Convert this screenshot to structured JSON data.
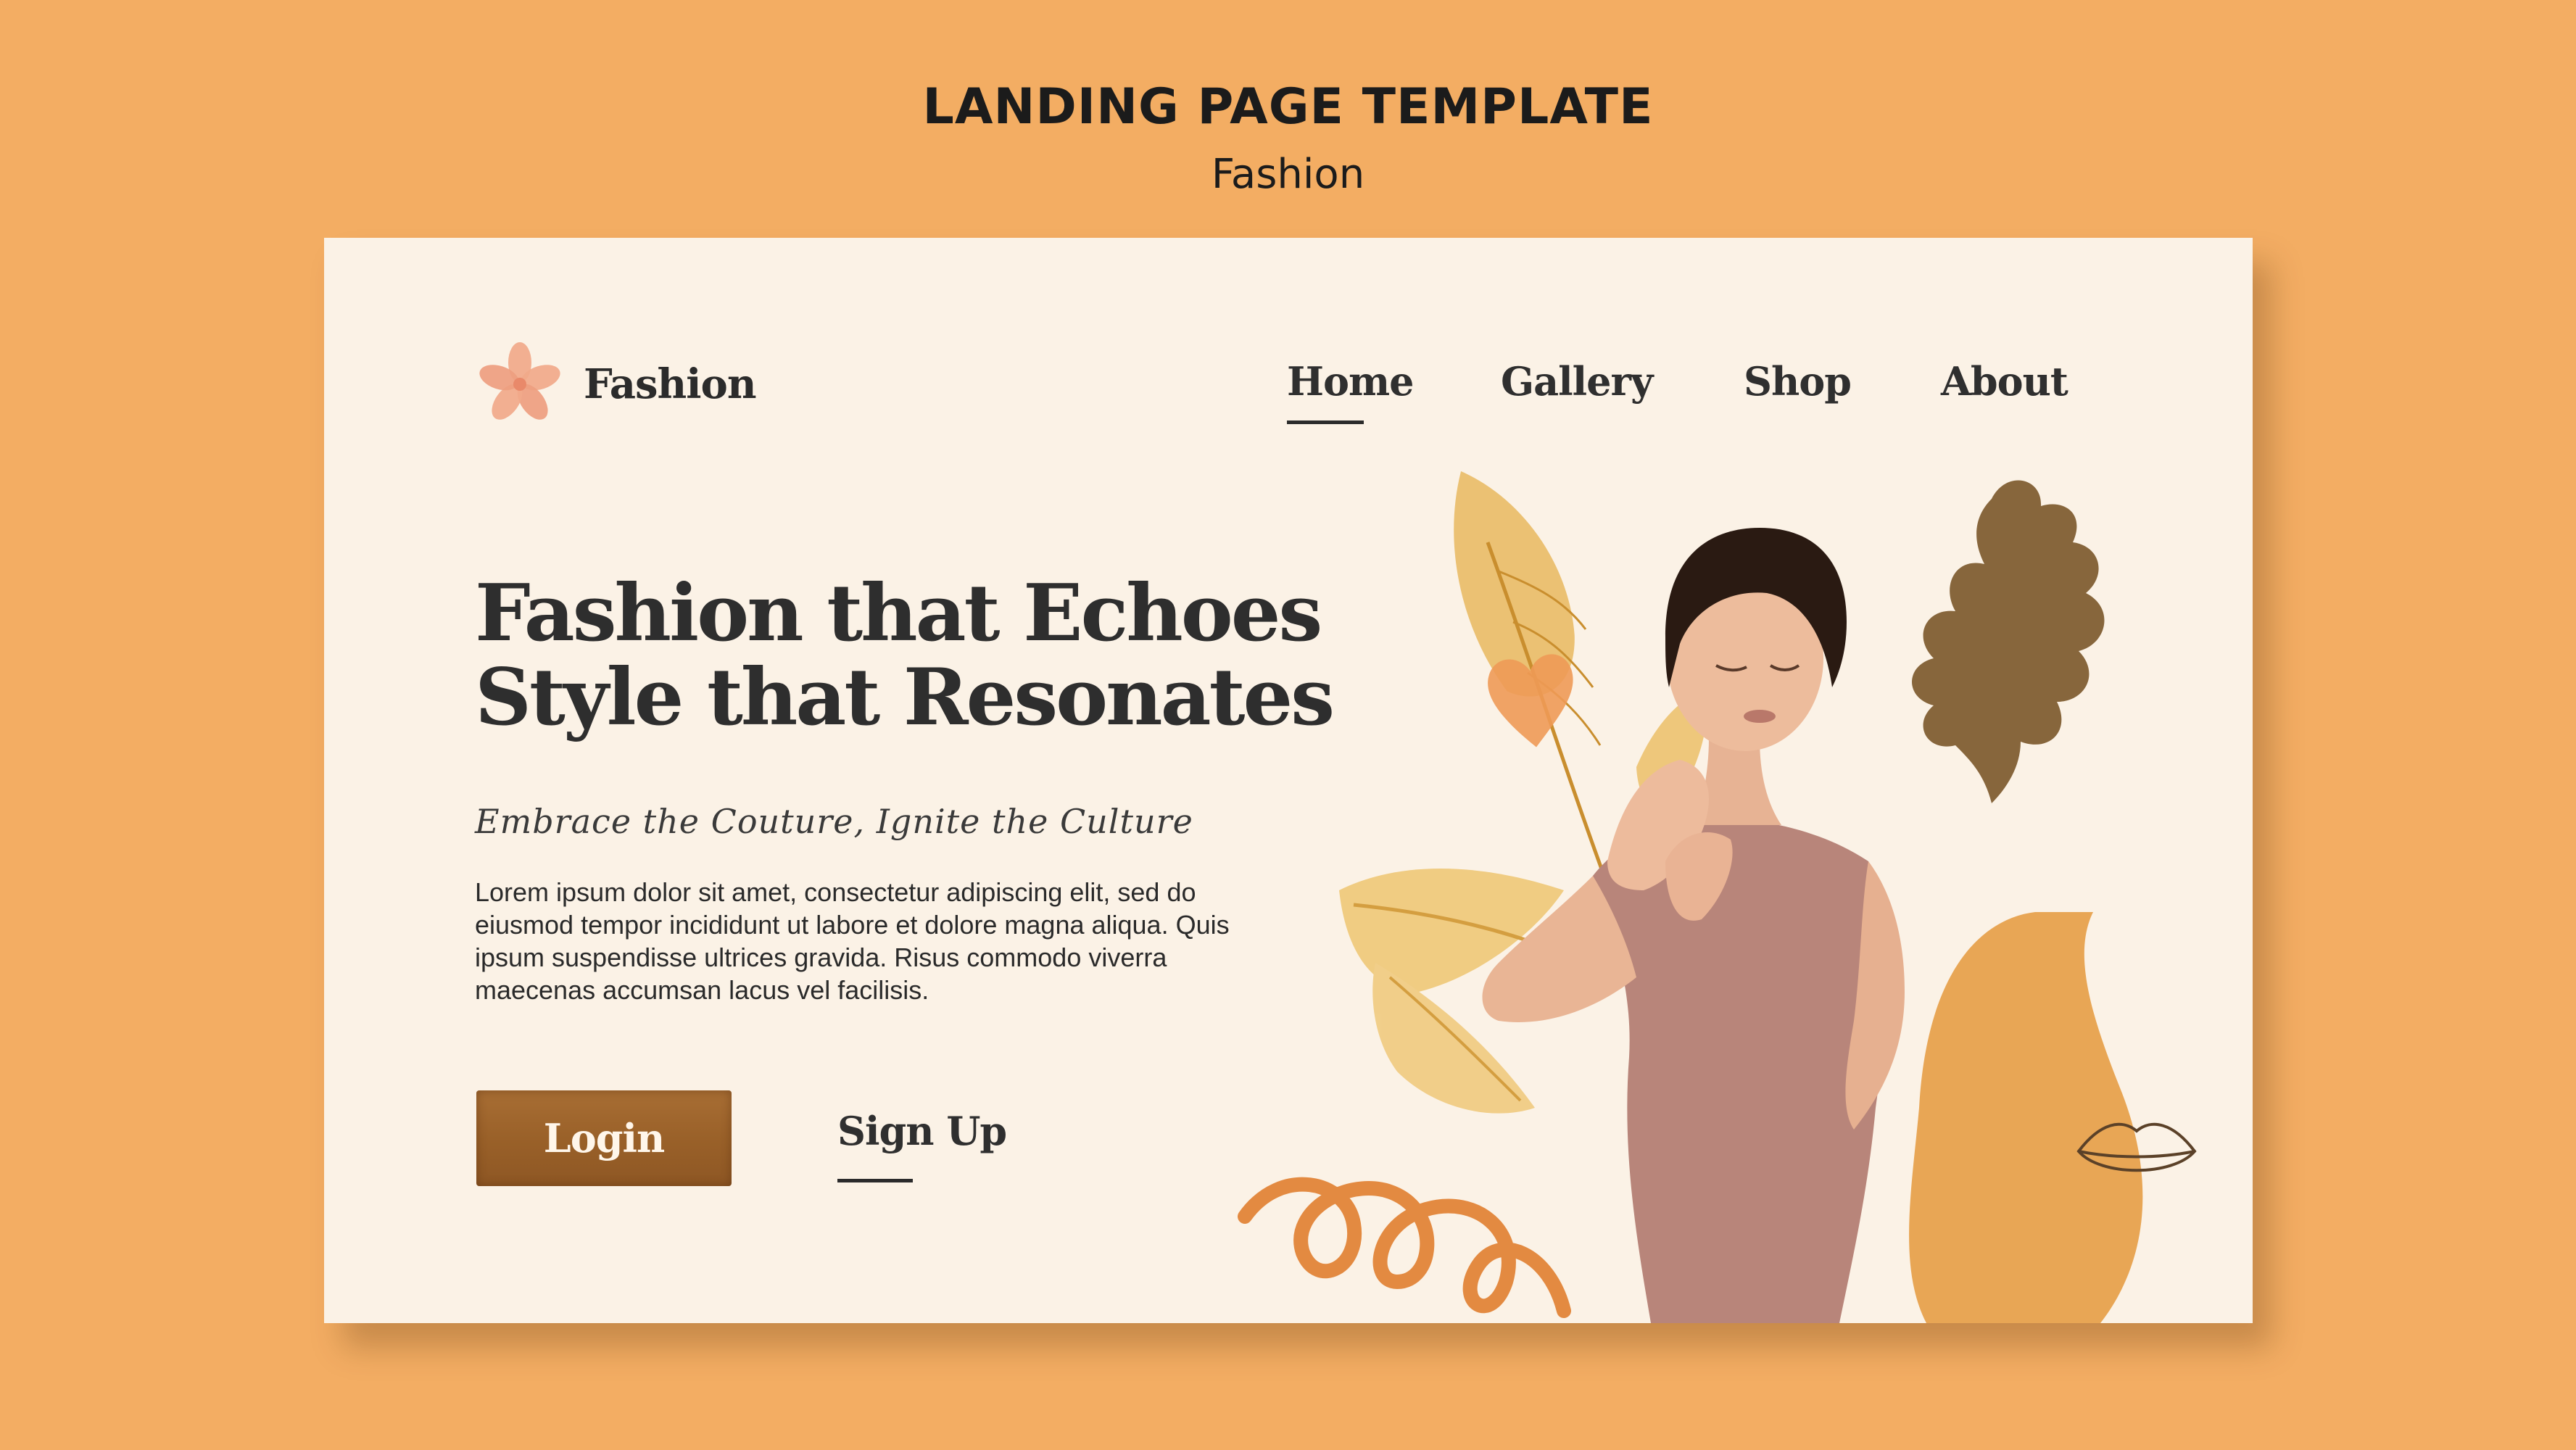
{
  "header": {
    "title": "LANDING PAGE TEMPLATE",
    "subtitle": "Fashion"
  },
  "site": {
    "logo_text": "Fashion",
    "logo_icon": "flower-icon"
  },
  "nav": {
    "items": [
      {
        "label": "Home",
        "active": true
      },
      {
        "label": "Gallery",
        "active": false
      },
      {
        "label": "Shop",
        "active": false
      },
      {
        "label": "About",
        "active": false
      }
    ]
  },
  "hero": {
    "title_line1": "Fashion that Echoes",
    "title_line2": "Style that Resonates",
    "tagline": "Embrace the Couture, Ignite the Culture",
    "body": "Lorem ipsum dolor sit amet, consectetur adipiscing elit, sed do eiusmod tempor incididunt ut labore et dolore magna aliqua. Quis ipsum suspendisse ultrices gravida. Risus commodo viverra maecenas accumsan lacus vel facilisis."
  },
  "actions": {
    "login_label": "Login",
    "signup_label": "Sign Up"
  },
  "colors": {
    "background": "#F3AD63",
    "card": "#FBF2E6",
    "text_dark": "#2E2E2E",
    "button_brown": "#9A6129",
    "accent_orange": "#E48A3E",
    "leaf_gold": "#E3B04D"
  }
}
